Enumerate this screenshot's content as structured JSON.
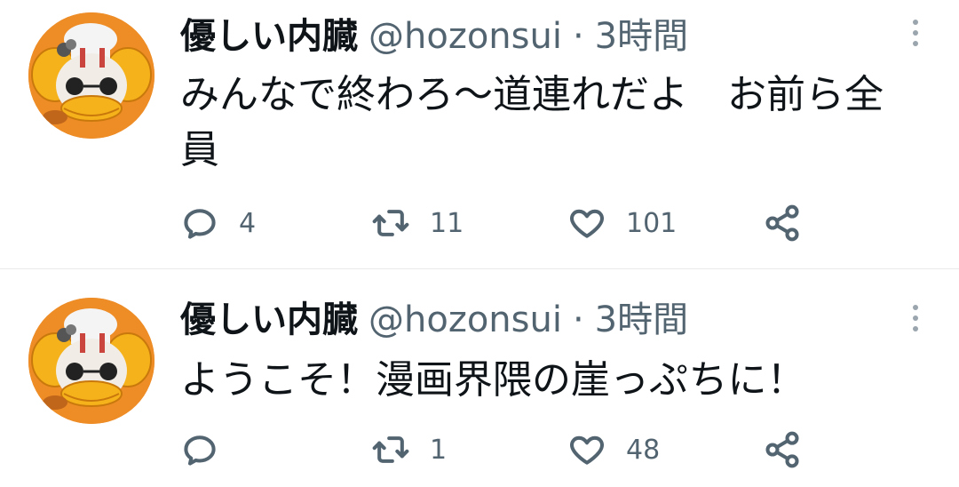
{
  "tweets": [
    {
      "display_name": "優しい内臓",
      "handle": "@hozonsui",
      "separator": "·",
      "time": "3時間",
      "text": "みんなで終わろ〜道連れだよ　お前ら全員",
      "replies": "4",
      "retweets": "11",
      "likes": "101"
    },
    {
      "display_name": "優しい内臓",
      "handle": "@hozonsui",
      "separator": "·",
      "time": "3時間",
      "text": "ようこそ！漫画界隈の崖っぷちに！",
      "replies": "",
      "retweets": "1",
      "likes": "48"
    }
  ],
  "icons": {
    "reply": "reply-icon",
    "retweet": "retweet-icon",
    "like": "heart-icon",
    "share": "share-icon",
    "more": "more-vertical-icon"
  },
  "colors": {
    "text_primary": "#0f1419",
    "text_secondary": "#536471",
    "divider": "#e7e9ea",
    "avatar_bg": "#ee8c26"
  }
}
